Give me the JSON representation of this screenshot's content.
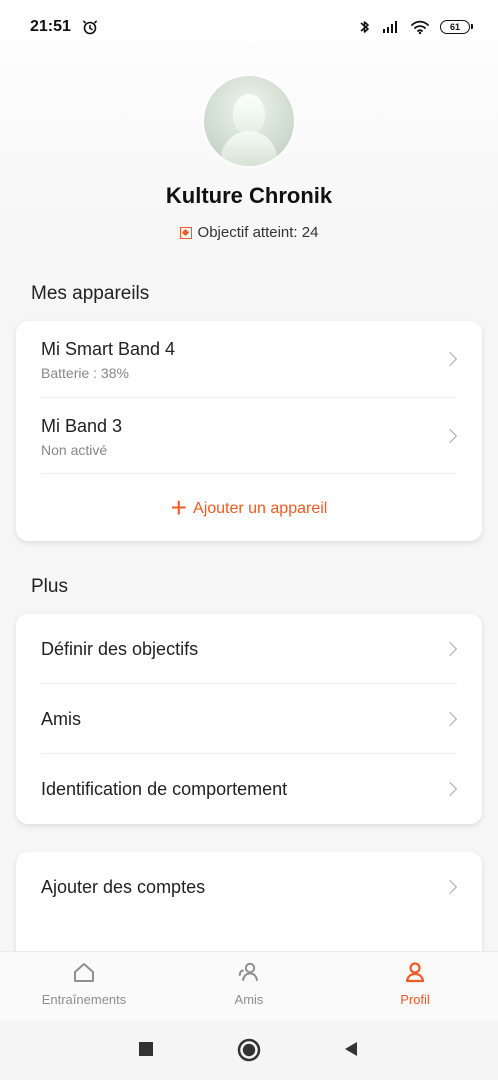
{
  "status_bar": {
    "time": "21:51",
    "battery": "61"
  },
  "profile": {
    "name": "Kulture Chronik",
    "goal_text": "Objectif atteint: 24"
  },
  "sections": {
    "devices_title": "Mes appareils",
    "more_title": "Plus"
  },
  "devices": [
    {
      "name": "Mi Smart Band 4",
      "status": "Batterie : 38%"
    },
    {
      "name": "Mi Band 3",
      "status": "Non activé"
    }
  ],
  "add_device_label": "Ajouter un appareil",
  "more_items": [
    "Définir des objectifs",
    "Amis",
    "Identification de comportement"
  ],
  "accounts_item": "Ajouter des comptes",
  "bottom_nav": [
    "Entraînements",
    "Amis",
    "Profil"
  ],
  "colors": {
    "accent": "#f15a24",
    "inactive": "#8f8f8f",
    "background": "#f6f6f6"
  },
  "icons": {
    "alarm": "alarm-icon",
    "bluetooth": "bluetooth-icon",
    "signal": "signal-icon",
    "wifi": "wifi-icon",
    "battery": "battery-icon",
    "home": "home-icon",
    "friends": "friends-icon",
    "profile": "profile-icon",
    "square": "square-icon",
    "circle": "circle-icon",
    "back": "back-triangle-icon"
  }
}
